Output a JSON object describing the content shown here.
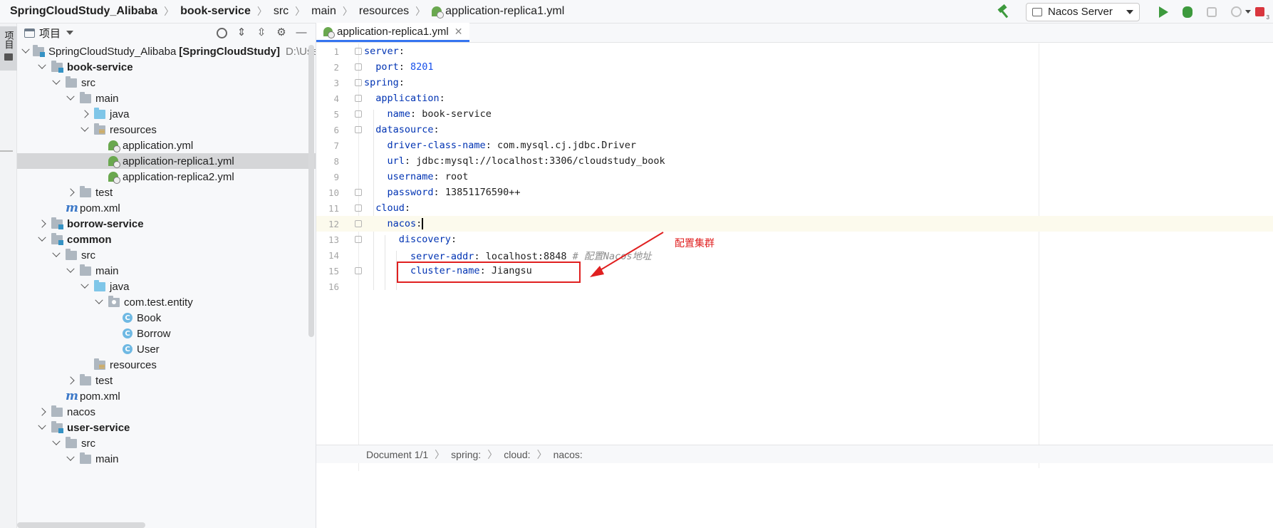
{
  "navbar": {
    "breadcrumbs": [
      "SpringCloudStudy_Alibaba",
      "book-service",
      "src",
      "main",
      "resources",
      "application-replica1.yml"
    ],
    "run_config": "Nacos Server"
  },
  "toolstrip": {
    "project_tab": "项目"
  },
  "project_panel": {
    "title": "项目",
    "tree": [
      {
        "label": "SpringCloudStudy_Alibaba",
        "extra": "[SpringCloudStudy]",
        "path": "D:\\Users\\"
      },
      {
        "label": "book-service"
      },
      {
        "label": "src"
      },
      {
        "label": "main"
      },
      {
        "label": "java"
      },
      {
        "label": "resources"
      },
      {
        "label": "application.yml"
      },
      {
        "label": "application-replica1.yml"
      },
      {
        "label": "application-replica2.yml"
      },
      {
        "label": "test"
      },
      {
        "label": "pom.xml"
      },
      {
        "label": "borrow-service"
      },
      {
        "label": "common"
      },
      {
        "label": "src"
      },
      {
        "label": "main"
      },
      {
        "label": "java"
      },
      {
        "label": "com.test.entity"
      },
      {
        "label": "Book"
      },
      {
        "label": "Borrow"
      },
      {
        "label": "User"
      },
      {
        "label": "resources"
      },
      {
        "label": "test"
      },
      {
        "label": "pom.xml"
      },
      {
        "label": "nacos"
      },
      {
        "label": "user-service"
      },
      {
        "label": "src"
      },
      {
        "label": "main"
      }
    ]
  },
  "editor": {
    "tab_label": "application-replica1.yml",
    "lines": [
      {
        "no": "1",
        "key": "server",
        "sep": ":",
        "val": ""
      },
      {
        "no": "2",
        "key": "port",
        "sep": ": ",
        "val": "8201"
      },
      {
        "no": "3",
        "key": "spring",
        "sep": ":",
        "val": ""
      },
      {
        "no": "4",
        "key": "application",
        "sep": ":",
        "val": ""
      },
      {
        "no": "5",
        "key": "name",
        "sep": ": ",
        "val": "book-service"
      },
      {
        "no": "6",
        "key": "datasource",
        "sep": ":",
        "val": ""
      },
      {
        "no": "7",
        "key": "driver-class-name",
        "sep": ": ",
        "val": "com.mysql.cj.jdbc.Driver"
      },
      {
        "no": "8",
        "key": "url",
        "sep": ": ",
        "val": "jdbc:mysql://localhost:3306/cloudstudy_book"
      },
      {
        "no": "9",
        "key": "username",
        "sep": ": ",
        "val": "root"
      },
      {
        "no": "10",
        "key": "password",
        "sep": ": ",
        "val": "13851176590++"
      },
      {
        "no": "11",
        "key": "cloud",
        "sep": ":",
        "val": ""
      },
      {
        "no": "12",
        "key": "nacos",
        "sep": ":",
        "val": ""
      },
      {
        "no": "13",
        "key": "discovery",
        "sep": ":",
        "val": ""
      },
      {
        "no": "14",
        "key": "server-addr",
        "sep": ": ",
        "val": "localhost:8848",
        "comment": "# 配置Nacos地址"
      },
      {
        "no": "15",
        "key": "cluster-name",
        "sep": ": ",
        "val": "Jiangsu"
      },
      {
        "no": "16",
        "key": "",
        "sep": "",
        "val": ""
      }
    ],
    "annotation": "配置集群"
  },
  "statusbar": {
    "items": [
      "Document 1/1",
      "spring:",
      "cloud:",
      "nacos:"
    ]
  },
  "colors": {
    "accent": "#3574f0",
    "yaml_key": "#0033b3",
    "number": "#1750eb",
    "annotation_red": "#e02020",
    "run_green": "#3d9a3d"
  }
}
